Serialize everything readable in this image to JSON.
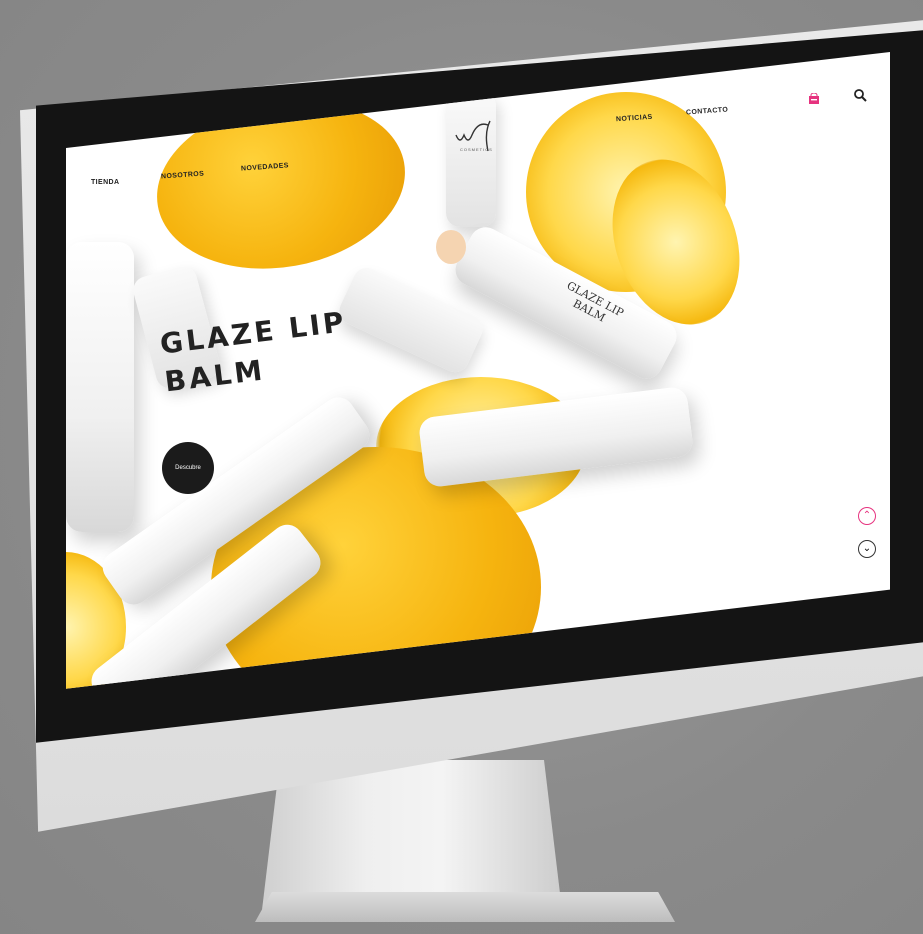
{
  "nav": {
    "items": [
      {
        "label": "TIENDA"
      },
      {
        "label": "NOSOTROS"
      },
      {
        "label": "NOVEDADES"
      },
      {
        "label": "NOTICIAS"
      },
      {
        "label": "CONTACTO"
      }
    ]
  },
  "logo": {
    "text": "wf",
    "subtitle": "COSMETICS"
  },
  "hero": {
    "title_line1": "GLAZE LIP",
    "title_line2": "BALM",
    "cta_label": "Descubre"
  },
  "product": {
    "label_line1": "GLAZE LIP",
    "label_line2": "BALM"
  },
  "icons": {
    "cart": "bag-icon",
    "search": "search-icon",
    "scroll_up": "chevron-up-icon",
    "scroll_down": "chevron-down-icon"
  },
  "colors": {
    "accent": "#e6337f",
    "lemon": "#f6b40f"
  }
}
